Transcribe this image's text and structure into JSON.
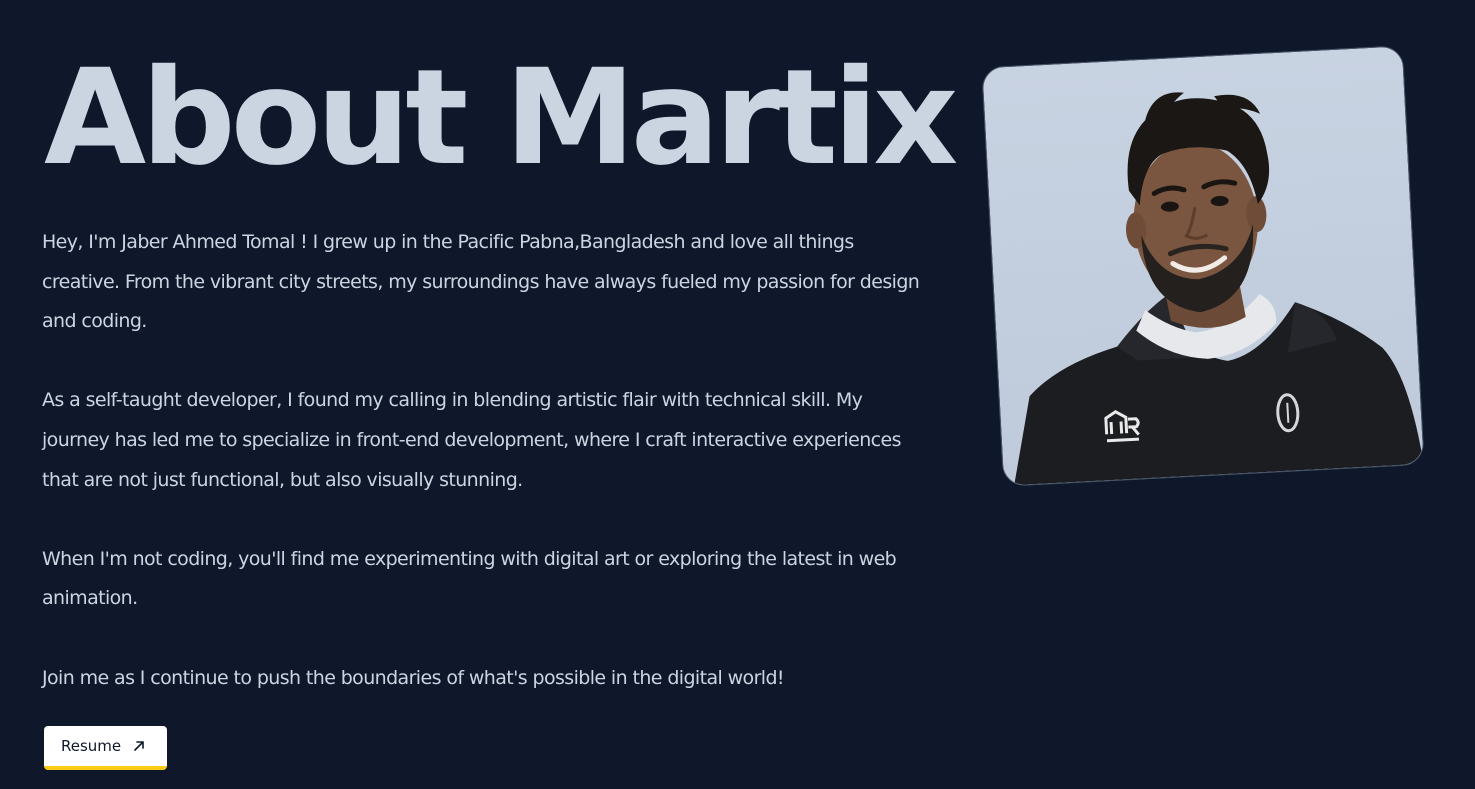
{
  "heading": {
    "title": "About Martix"
  },
  "bio": {
    "paragraphs": [
      "Hey, I'm Jaber Ahmed Tomal ! I grew up in the Pacific Pabna,Bangladesh and love all things creative. From the vibrant city streets, my surroundings have always fueled my passion for design and coding.",
      "As a self-taught developer, I found my calling in blending artistic flair with technical skill. My journey has led me to specialize in front-end development, where I craft interactive experiences that are not just functional, but also visually stunning.",
      "When I'm not coding, you'll find me experimenting with digital art or exploring the latest in web animation.",
      "Join me as I continue to push the boundaries of what's possible in the digital world!"
    ]
  },
  "resume_button": {
    "label": "Resume",
    "icon": "arrow-up-right-icon"
  },
  "profile_photo": {
    "subject": "portrait of a smiling man in a black hoodie"
  },
  "colors": {
    "background": "#0f172a",
    "text": "#cbd5e1",
    "button_bg": "#ffffff",
    "button_accent": "#facc15"
  }
}
